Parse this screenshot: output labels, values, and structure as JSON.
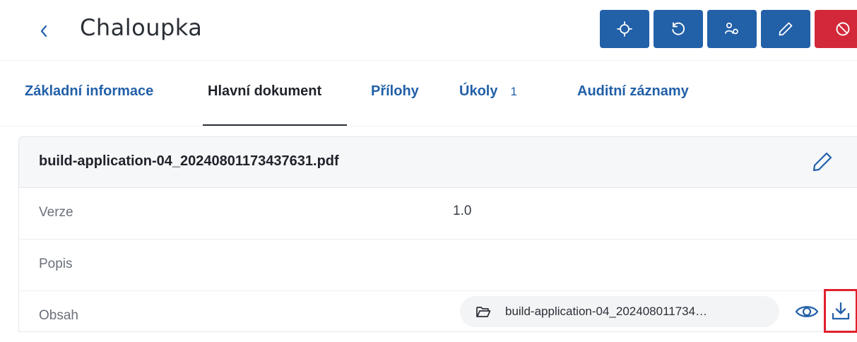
{
  "header": {
    "title": "Chaloupka",
    "actions": [
      {
        "icon": "crosshair-icon"
      },
      {
        "icon": "rotate-left-icon"
      },
      {
        "icon": "users-icon"
      },
      {
        "icon": "pencil-icon"
      },
      {
        "icon": "prohibit-icon"
      }
    ],
    "colors": {
      "primary": "#2260a8",
      "danger": "#d3283a"
    }
  },
  "tabs": [
    {
      "label": "Základní informace",
      "active": false
    },
    {
      "label": "Hlavní dokument",
      "active": true
    },
    {
      "label": "Přílohy",
      "active": false
    },
    {
      "label": "Úkoly",
      "badge": "1",
      "active": false
    },
    {
      "label": "Auditní záznamy",
      "active": false
    }
  ],
  "document": {
    "file_name": "build-application-04_20240801173437631.pdf",
    "rows": [
      {
        "label": "Verze",
        "value": "1.0"
      },
      {
        "label": "Popis",
        "value": ""
      },
      {
        "label": "Obsah",
        "value": ""
      }
    ],
    "content_file": "build-application-04_202408011734…"
  }
}
